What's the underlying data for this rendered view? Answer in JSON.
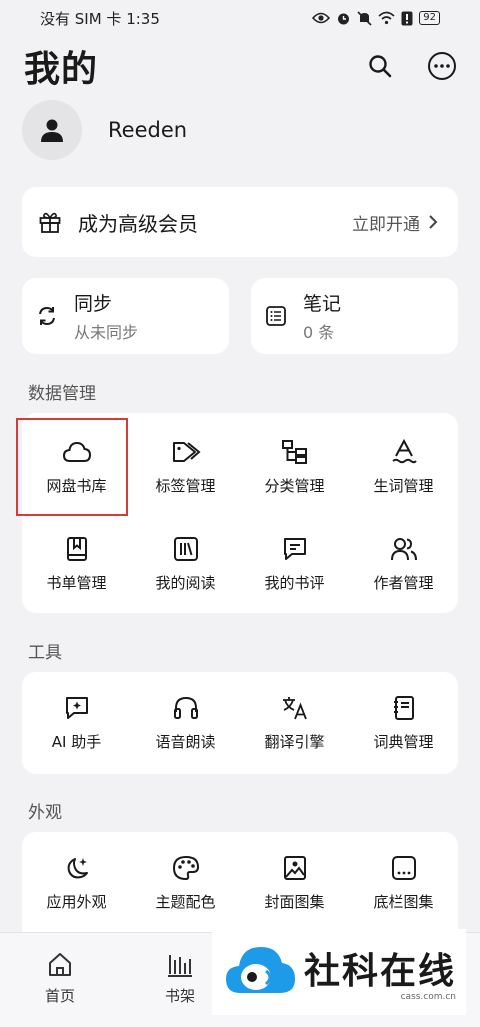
{
  "status_bar": {
    "left_text": "没有 SIM 卡 1:35",
    "battery": "92"
  },
  "header": {
    "title": "我的"
  },
  "profile": {
    "username": "Reeden"
  },
  "vip": {
    "label": "成为高级会员",
    "action": "立即开通"
  },
  "sync": {
    "title": "同步",
    "subtitle": "从未同步"
  },
  "notes": {
    "title": "笔记",
    "subtitle": "0 条"
  },
  "sections": {
    "data": {
      "title": "数据管理",
      "items": [
        {
          "label": "网盘书库",
          "icon": "cloud-icon"
        },
        {
          "label": "标签管理",
          "icon": "tags-icon"
        },
        {
          "label": "分类管理",
          "icon": "category-tree-icon"
        },
        {
          "label": "生词管理",
          "icon": "vocabulary-icon"
        },
        {
          "label": "书单管理",
          "icon": "booklist-icon"
        },
        {
          "label": "我的阅读",
          "icon": "reading-shelf-icon"
        },
        {
          "label": "我的书评",
          "icon": "review-chat-icon"
        },
        {
          "label": "作者管理",
          "icon": "authors-icon"
        }
      ]
    },
    "tools": {
      "title": "工具",
      "items": [
        {
          "label": "AI 助手",
          "icon": "ai-chat-icon"
        },
        {
          "label": "语音朗读",
          "icon": "headphones-icon"
        },
        {
          "label": "翻译引擎",
          "icon": "translate-icon"
        },
        {
          "label": "词典管理",
          "icon": "dictionary-icon"
        }
      ]
    },
    "appearance": {
      "title": "外观",
      "items": [
        {
          "label": "应用外观",
          "icon": "moon-stars-icon"
        },
        {
          "label": "主题配色",
          "icon": "palette-icon"
        },
        {
          "label": "封面图集",
          "icon": "image-icon"
        },
        {
          "label": "底栏图集",
          "icon": "bottom-bar-icon"
        }
      ]
    }
  },
  "bottom_nav": [
    {
      "label": "首页",
      "icon": "home-icon"
    },
    {
      "label": "书架",
      "icon": "bookshelf-chart-icon"
    }
  ],
  "watermark": {
    "main": "社科在线",
    "sub": "cass.com.cn"
  },
  "colors": {
    "highlight": "#d63a3a",
    "watermark_blue": "#1e9be8"
  }
}
